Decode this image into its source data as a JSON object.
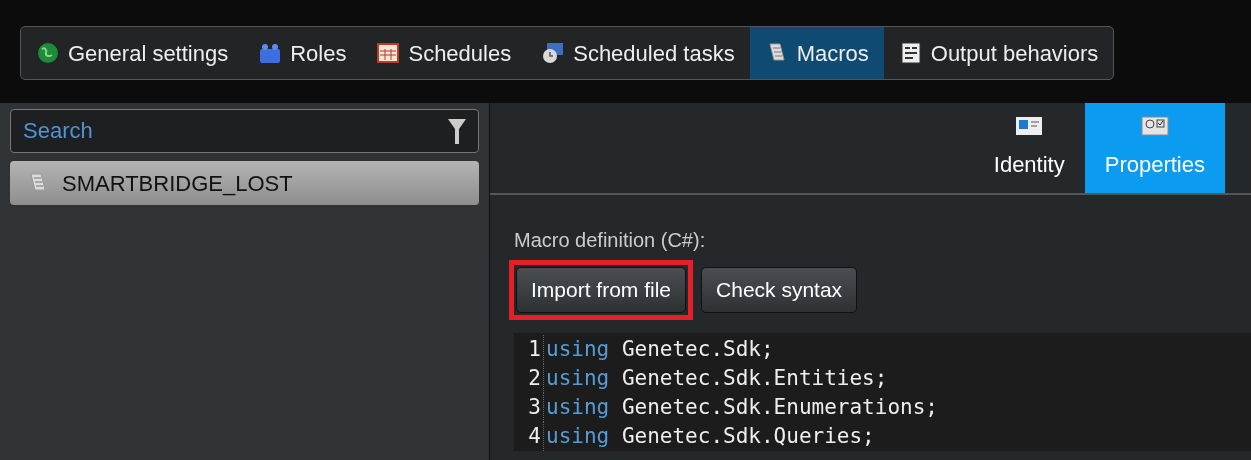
{
  "toolbar": {
    "tabs": [
      {
        "label": "General settings",
        "kind": "globe",
        "selected": false
      },
      {
        "label": "Roles",
        "kind": "blocks",
        "selected": false
      },
      {
        "label": "Schedules",
        "kind": "calendar",
        "selected": false
      },
      {
        "label": "Scheduled tasks",
        "kind": "clock",
        "selected": false
      },
      {
        "label": "Macros",
        "kind": "scroll",
        "selected": true
      },
      {
        "label": "Output behaviors",
        "kind": "list",
        "selected": false
      }
    ]
  },
  "sidebar": {
    "search": {
      "placeholder": "Search"
    },
    "items": [
      {
        "label": "SMARTBRIDGE_LOST",
        "selected": true
      }
    ]
  },
  "panel_tabs": [
    {
      "label": "Identity",
      "kind": "card",
      "selected": false
    },
    {
      "label": "Properties",
      "kind": "settings",
      "selected": true
    }
  ],
  "macro": {
    "label": "Macro definition (C#):",
    "buttons": [
      {
        "label": "Import from file",
        "highlighted": true
      },
      {
        "label": "Check syntax",
        "highlighted": false
      }
    ],
    "code": [
      {
        "number": "1",
        "keyword": "using",
        "text": "Genetec.Sdk;"
      },
      {
        "number": "2",
        "keyword": "using",
        "text": "Genetec.Sdk.Entities;"
      },
      {
        "number": "3",
        "keyword": "using",
        "text": "Genetec.Sdk.Enumerations;"
      },
      {
        "number": "4",
        "keyword": "using",
        "text": "Genetec.Sdk.Queries;"
      }
    ]
  }
}
